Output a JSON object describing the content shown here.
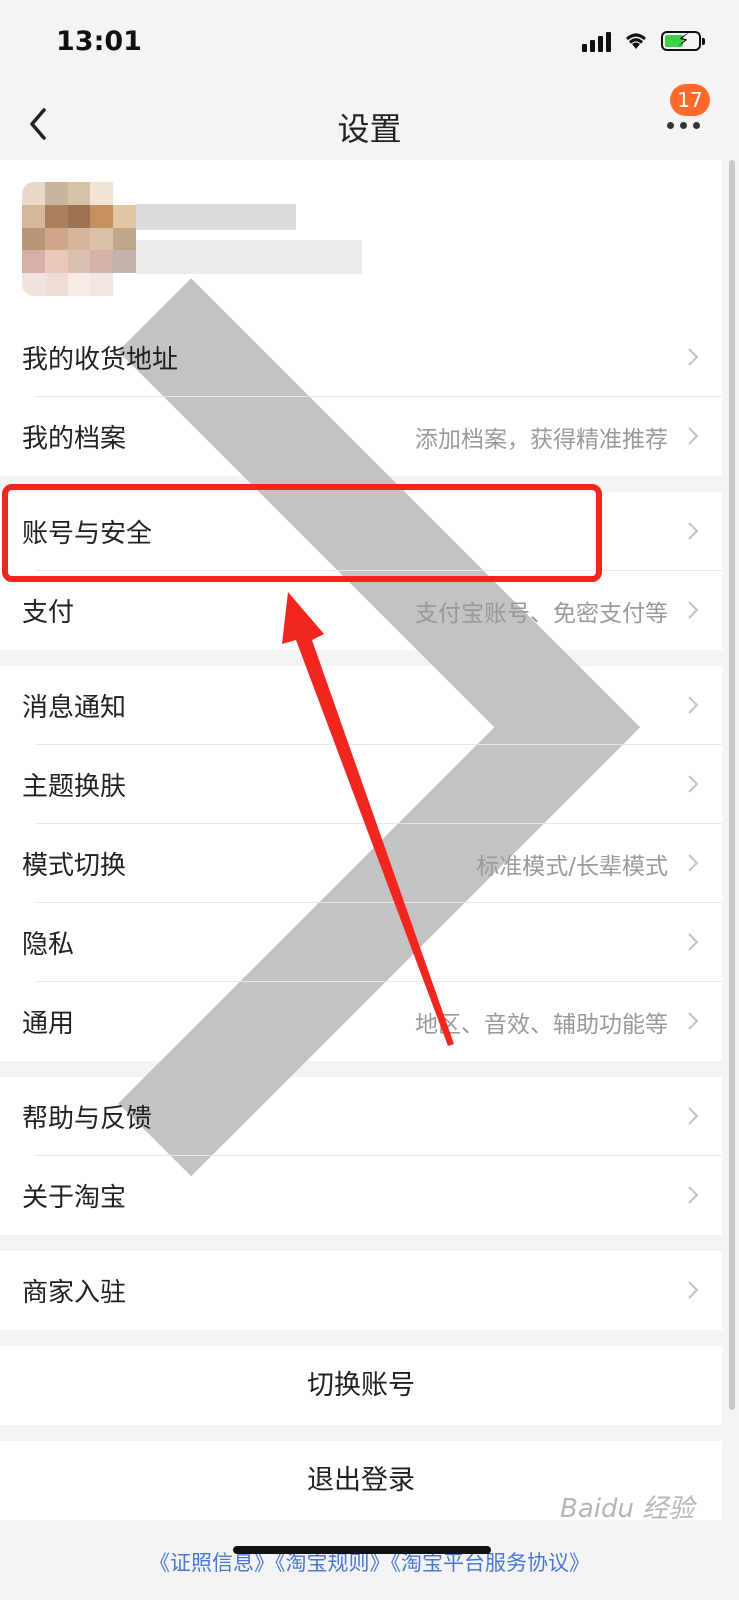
{
  "status_bar": {
    "time": "13:01"
  },
  "nav": {
    "title": "设置",
    "badge_count": "17"
  },
  "sections": [
    {
      "rows": [
        {
          "label": "我的收货地址",
          "hint": ""
        },
        {
          "label": "我的档案",
          "hint": "添加档案，获得精准推荐"
        }
      ]
    },
    {
      "rows": [
        {
          "label": "账号与安全",
          "hint": ""
        },
        {
          "label": "支付",
          "hint": "支付宝账号、免密支付等"
        }
      ]
    },
    {
      "rows": [
        {
          "label": "消息通知",
          "hint": ""
        },
        {
          "label": "主题换肤",
          "hint": ""
        },
        {
          "label": "模式切换",
          "hint": "标准模式/长辈模式"
        },
        {
          "label": "隐私",
          "hint": ""
        },
        {
          "label": "通用",
          "hint": "地区、音效、辅助功能等"
        }
      ]
    },
    {
      "rows": [
        {
          "label": "帮助与反馈",
          "hint": ""
        },
        {
          "label": "关于淘宝",
          "hint": ""
        }
      ]
    },
    {
      "rows": [
        {
          "label": "商家入驻",
          "hint": ""
        }
      ]
    }
  ],
  "actions": {
    "switch_account": "切换账号",
    "logout": "退出登录"
  },
  "footer": {
    "links": "《证照信息》《淘宝规则》《淘宝平台服务协议》"
  },
  "watermark": "Baidu 经验",
  "colors": {
    "accent": "#ff6a2b",
    "annotation": "#f2261f",
    "hint": "#9a9a9a"
  }
}
